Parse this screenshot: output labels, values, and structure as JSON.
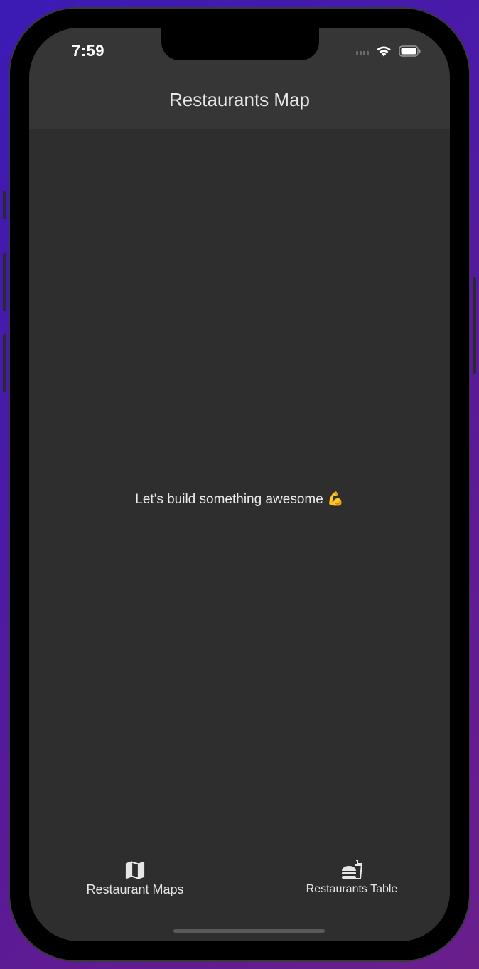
{
  "status_bar": {
    "time": "7:59",
    "signal_icon": "cellular-signal-icon",
    "wifi_icon": "wifi-icon",
    "battery_icon": "battery-icon"
  },
  "nav": {
    "title": "Restaurants Map"
  },
  "main": {
    "message": "Let's build something awesome 💪"
  },
  "tabs": [
    {
      "label": "Restaurant Maps",
      "icon": "map-icon"
    },
    {
      "label": "Restaurants Table",
      "icon": "fastfood-icon"
    }
  ],
  "colors": {
    "background_gradient_start": "#3b1bb5",
    "background_gradient_end": "#6a1e8c",
    "screen_bg": "#2e2e2e",
    "navbar_bg": "#363636",
    "text": "#e8e8e8"
  }
}
